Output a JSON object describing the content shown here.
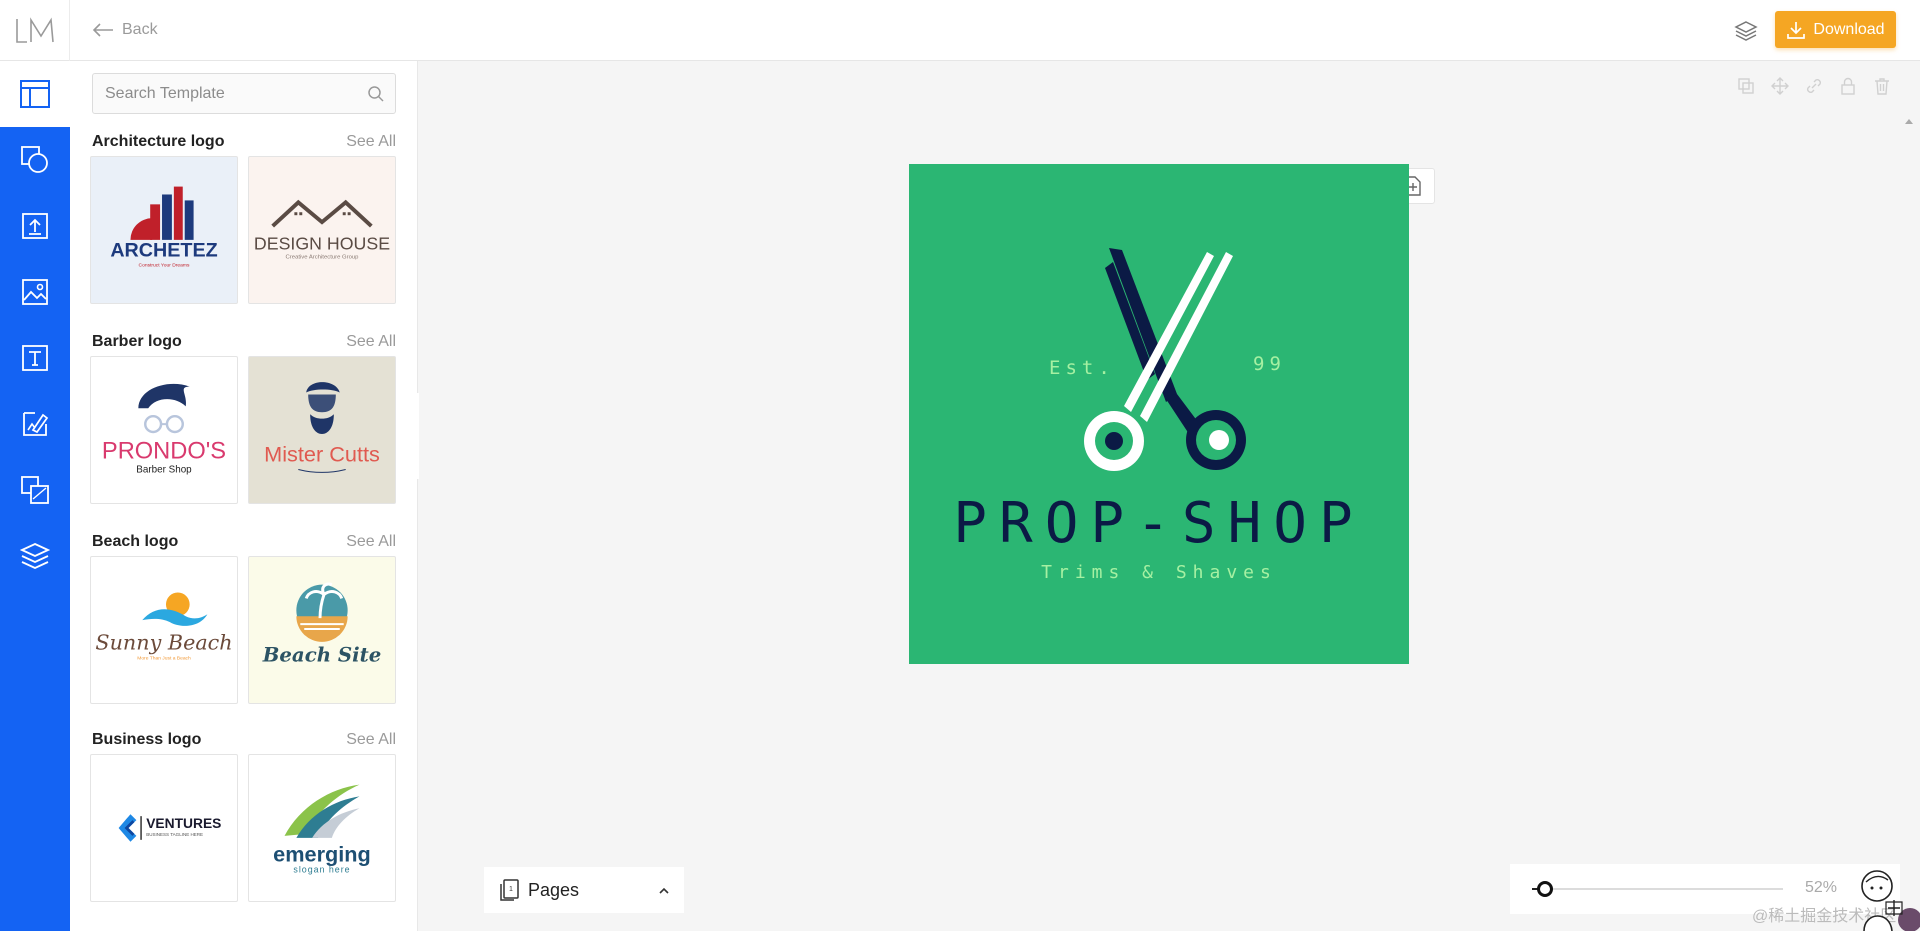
{
  "header": {
    "logo_text": "LM",
    "back_label": "Back",
    "download_label": "Download"
  },
  "rail": {
    "items": [
      {
        "icon": "template-icon",
        "active": true
      },
      {
        "icon": "shapes-icon"
      },
      {
        "icon": "upload-icon"
      },
      {
        "icon": "image-icon"
      },
      {
        "icon": "text-icon"
      },
      {
        "icon": "background-icon"
      },
      {
        "icon": "elements-icon"
      },
      {
        "icon": "layers-icon"
      }
    ]
  },
  "panel": {
    "search_placeholder": "Search Template",
    "see_all_label": "See All",
    "categories": [
      {
        "title": "Architecture logo",
        "thumbs": [
          "ARCHETEZ",
          "DESIGN HOUSE"
        ],
        "taglines": [
          "Construct Your Dreams",
          "Creative Architecture Group"
        ]
      },
      {
        "title": "Barber logo",
        "thumbs": [
          "PRONDO'S",
          "Mister Cutts"
        ],
        "taglines": [
          "Barber Shop",
          ""
        ]
      },
      {
        "title": "Beach logo",
        "thumbs": [
          "Sunny Beach",
          "Beach Site"
        ],
        "taglines": [
          "More Than Just a Beach",
          ""
        ]
      },
      {
        "title": "Business logo",
        "thumbs": [
          "VENTURES",
          "emerging"
        ],
        "taglines": [
          "BUSINESS TAGLINE HERE",
          "slogan here"
        ]
      }
    ]
  },
  "canvas": {
    "brand": "PROP-SHOP",
    "tagline": "Trims & Shaves",
    "est_left": "Est.",
    "est_right": "99",
    "background_color": "#2bb673",
    "dark_color": "#0b1a45",
    "light_color": "#a6f0a2"
  },
  "pages_label": "Pages",
  "zoom": {
    "value_label": "52%",
    "fraction": 0.05
  },
  "watermark": "@稀土掘金技术社区",
  "colors": {
    "rail": "#1463f3",
    "accent": "#f5a623"
  }
}
